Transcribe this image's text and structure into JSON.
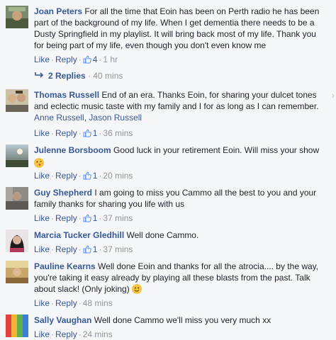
{
  "comments": [
    {
      "name": "Joan Peters",
      "text": "For all the time that Eoin has been on Perth radio he has been part of the background of my life. When I get dementia there needs to be a Dusty Springfield in my playlist. It will bring back most of my life. Thank you for being part of my life, even though you don't even know me",
      "like": "Like",
      "reply": "Reply",
      "likes": "4",
      "time": "1 hr",
      "replies_label": "2 Replies",
      "replies_time": "40 mins"
    },
    {
      "name": "Thomas Russell",
      "text": "End of an era. Thanks Eoin, for sharing your dulcet tones and eclectic music taste with my family and I for as long as I can remember.",
      "tags": [
        "Anne Russell",
        "Jason Russell"
      ],
      "like": "Like",
      "reply": "Reply",
      "likes": "1",
      "time": "36 mins"
    },
    {
      "name": "Julenne Borsboom",
      "text": "Good luck in your retirement Eoin. Will miss your show",
      "like": "Like",
      "reply": "Reply",
      "likes": "1",
      "time": "20 mins"
    },
    {
      "name": "Guy Shepherd",
      "text": "I am going to miss you Cammo all the best to you and your family thanks for sharing you life with us",
      "like": "Like",
      "reply": "Reply",
      "likes": "1",
      "time": "37 mins"
    },
    {
      "name": "Marcia Tucker Gledhill",
      "text": "Well done Cammo.",
      "like": "Like",
      "reply": "Reply",
      "likes": "1",
      "time": "37 mins"
    },
    {
      "name": "Pauline Kearns",
      "text": "Well done Eoin and thanks for all the atrocia.... by the way, you're taking it easy already by playing all these blasts from the past. Talk about slack! (Only joking)",
      "like": "Like",
      "reply": "Reply",
      "time": "48 mins"
    },
    {
      "name": "Sally Vaughan",
      "text": "Well done Cammo we'll miss you very much xx",
      "like": "Like",
      "reply": "Reply",
      "time": "24 mins"
    }
  ],
  "colors": {
    "link": "#365899",
    "meta": "#90949c",
    "text": "#1d2129",
    "background": "#f6f7f9"
  }
}
